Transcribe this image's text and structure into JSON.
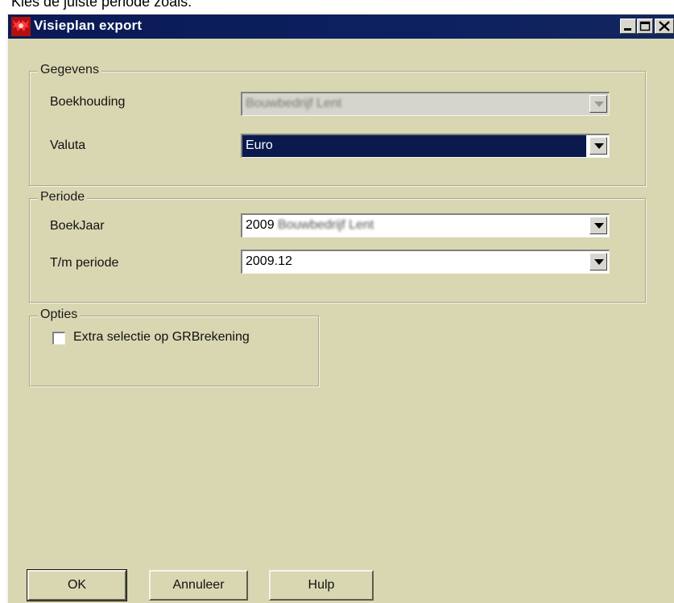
{
  "caption": "Kies de juiste periode zoals:",
  "window": {
    "title": "Visieplan export",
    "controls": {
      "minimize": "minimize-icon",
      "maximize": "maximize-icon",
      "close": "close-icon"
    }
  },
  "groups": {
    "gegevens": {
      "title": "Gegevens",
      "boekhouding": {
        "label": "Boekhouding",
        "value": "Bouwbedrijf Lent",
        "disabled": true
      },
      "valuta": {
        "label": "Valuta",
        "value": "Euro",
        "selected": true
      }
    },
    "periode": {
      "title": "Periode",
      "boekjaar": {
        "label": "BoekJaar",
        "year": "2009",
        "value_rest": "Bouwbedrijf Lent"
      },
      "tm_periode": {
        "label": "T/m periode",
        "value": "2009.12"
      }
    },
    "opties": {
      "title": "Opties",
      "extra_selectie": {
        "label": "Extra selectie op GRBrekening",
        "checked": false
      }
    }
  },
  "buttons": {
    "ok": "OK",
    "annuleer": "Annuleer",
    "hulp": "Hulp"
  },
  "colors": {
    "titlebar": "#0a1a55",
    "dialog_bg": "#d8d7b2",
    "selection": "#0a1a4d"
  }
}
